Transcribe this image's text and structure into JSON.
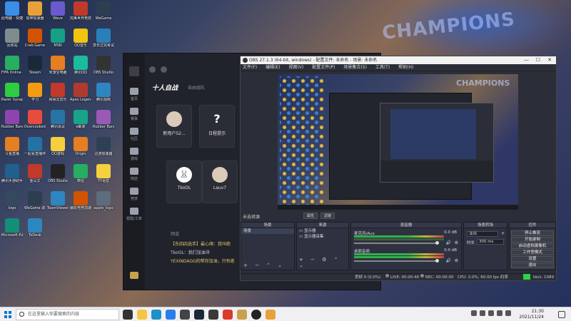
{
  "wallpaper": {
    "text": "CHAMPIONS"
  },
  "desktop_icons": [
    {
      "label": "此电脑 - 快捷方式",
      "color": "#3a8ee8"
    },
    {
      "label": "雷神加速器",
      "color": "#e8a13a"
    },
    {
      "label": "Wave",
      "color": "#6a5acd"
    },
    {
      "label": "完美世界竞技平台",
      "color": "#c0392b"
    },
    {
      "label": "WeGame",
      "color": "#2c3e50"
    },
    {
      "label": "回收站",
      "color": "#7f8c8d"
    },
    {
      "label": "Crab Game",
      "color": "#d35400"
    },
    {
      "label": "MSN",
      "color": "#16a085"
    },
    {
      "label": "QQ音乐",
      "color": "#f1c40f"
    },
    {
      "label": "享年过完考试手册",
      "color": "#2980b9"
    },
    {
      "label": "FIFA Online 4",
      "color": "#27ae60"
    },
    {
      "label": "Steam",
      "color": "#1b2838"
    },
    {
      "label": "米游宝电脑",
      "color": "#e67e22"
    },
    {
      "label": "腾讯QQ",
      "color": "#1abc9c"
    },
    {
      "label": "OBS Studio",
      "color": "#333333"
    },
    {
      "label": "Razer Synapse",
      "color": "#2ecc40"
    },
    {
      "label": "学习",
      "color": "#f39c12"
    },
    {
      "label": "网易云音乐",
      "color": "#c0392b"
    },
    {
      "label": "Apex Legends",
      "color": "#b03a2e"
    },
    {
      "label": "腾讯视频",
      "color": "#2e86c1"
    },
    {
      "label": "Rubber Bandits",
      "color": "#8e44ad"
    },
    {
      "label": "Overcooked 2",
      "color": "#e74c3c"
    },
    {
      "label": "腾讯会议",
      "color": "#2874a6"
    },
    {
      "label": "e邮家",
      "color": "#17a589"
    },
    {
      "label": "Rubber Bandits",
      "color": "#9b59b6"
    },
    {
      "label": "斗鱼直播",
      "color": "#e67e22"
    },
    {
      "label": "一起看直播伴侣",
      "color": "#2471a3"
    },
    {
      "label": "QQ游戏",
      "color": "#f4d03f"
    },
    {
      "label": "Origin",
      "color": "#e67e22"
    },
    {
      "label": "迅游加速器",
      "color": "#2e4053"
    },
    {
      "label": "腾讯手游助手",
      "color": "#1f618d"
    },
    {
      "label": "金山文",
      "color": "#c0392b"
    },
    {
      "label": "OBS Studio",
      "color": "#222222"
    },
    {
      "label": "微信",
      "color": "#27ae60"
    },
    {
      "label": "YY语音",
      "color": "#f4d03f"
    },
    {
      "label": "logo",
      "color": "#34495e"
    },
    {
      "label": "WeGame 助手",
      "color": "#2c3e50"
    },
    {
      "label": "TeamViewer",
      "color": "#2e86c1"
    },
    {
      "label": "暴影电竞加速器",
      "color": "#d35400"
    },
    {
      "label": "apple_logo",
      "color": "#5d6d7e"
    },
    {
      "label": "Microsoft Edge",
      "color": "#148f77"
    },
    {
      "label": "ToDesk",
      "color": "#2e86c1"
    }
  ],
  "tournament_app": {
    "brand": "十人自战",
    "subtitle": "自由组队",
    "nav": [
      "首页",
      "赛事",
      "社区",
      "游戏",
      "商店",
      "竞技"
    ],
    "footer_nav": "帮助/工单",
    "cards": [
      {
        "name": "新用户52...",
        "avatar": "avatar"
      },
      {
        "name": "日程提示",
        "avatar": "?"
      },
      {
        "name": "TkoOL",
        "avatar": "rabbit"
      },
      {
        "name": "Lauv7",
        "avatar": "avatar"
      }
    ],
    "chat_title": "频道",
    "chat_lines": [
      {
        "text": "【东四四选手】最心绪：我叫绝",
        "style": "gold"
      },
      {
        "text": "TkoOL：我们加油冲",
        "style": "white"
      },
      {
        "text": "YEXINDAGG的帮你加油，只有绝",
        "style": "gold"
      }
    ]
  },
  "obs": {
    "title": "OBS 27.1.3 (64-bit, windows) - 配置文件: 未命名 - 场景: 未命名",
    "menu": [
      "文件(F)",
      "编辑(E)",
      "视图(V)",
      "配置文件(P)",
      "场景集合(S)",
      "工具(T)",
      "帮助(H)"
    ],
    "no_source": "未选择源",
    "toolbar_props": "属性",
    "toolbar_filters": "滤镜",
    "docks": {
      "scenes": {
        "title": "场景",
        "items": [
          "场景"
        ]
      },
      "sources": {
        "title": "来源",
        "items": [
          "显示器",
          "显示器采集"
        ]
      },
      "mixer": {
        "title": "混音器",
        "channels": [
          {
            "name": "麦克风/Aux",
            "db": "0.0 dB"
          },
          {
            "name": "桌面音频",
            "db": "0.0 dB"
          }
        ]
      },
      "transitions": {
        "title": "场景转场",
        "type": "淡出",
        "duration_label": "时长",
        "duration": "300 ms"
      },
      "controls": {
        "title": "控件",
        "buttons": [
          "停止推流",
          "开始录制",
          "启动虚拟摄像机",
          "工作室模式",
          "设置",
          "退出"
        ]
      }
    },
    "status": {
      "dropped": "丢帧 0 (0.0%)",
      "live": "LIVE: 00:00:46",
      "rec": "REC: 00:00:00",
      "cpu": "CPU: 2.0%, 60.00 fps",
      "bitrate_label": "码率",
      "bitrate_value": "kb/s: 1089"
    }
  },
  "taskbar": {
    "search_placeholder": "在这里输入你要搜索的内容",
    "time": "21:30",
    "date": "2021/11/24"
  }
}
